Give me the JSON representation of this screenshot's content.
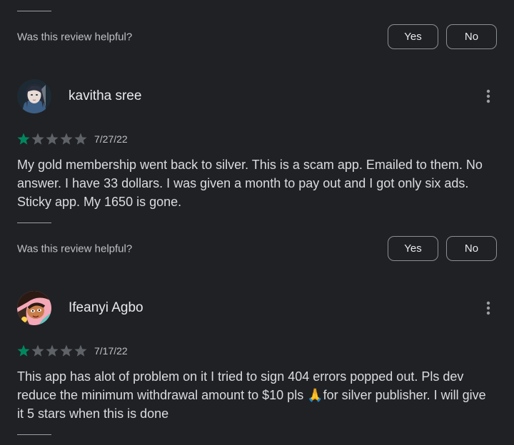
{
  "colors": {
    "background": "#202124",
    "star_filled": "#01875f",
    "star_empty": "#5f6368"
  },
  "helpful_prompt": "Was this review helpful?",
  "vote_yes": "Yes",
  "vote_no": "No",
  "reviews": [
    {
      "author": "kavitha sree",
      "rating": 1,
      "rating_max": 5,
      "date": "7/27/22",
      "text": "My gold membership went back to silver. This is a scam app. Emailed to them. No answer. I have 33 dollars. I was given a month to pay out and I got only six ads. Sticky app. My 1650 is gone."
    },
    {
      "author": "Ifeanyi Agbo",
      "rating": 1,
      "rating_max": 5,
      "date": "7/17/22",
      "text": "This app has alot of problem on it I tried to sign 404 errors popped out. Pls dev reduce the minimum withdrawal amount to $10 pls 🙏for silver publisher. I will give it 5 stars when this is done"
    }
  ]
}
